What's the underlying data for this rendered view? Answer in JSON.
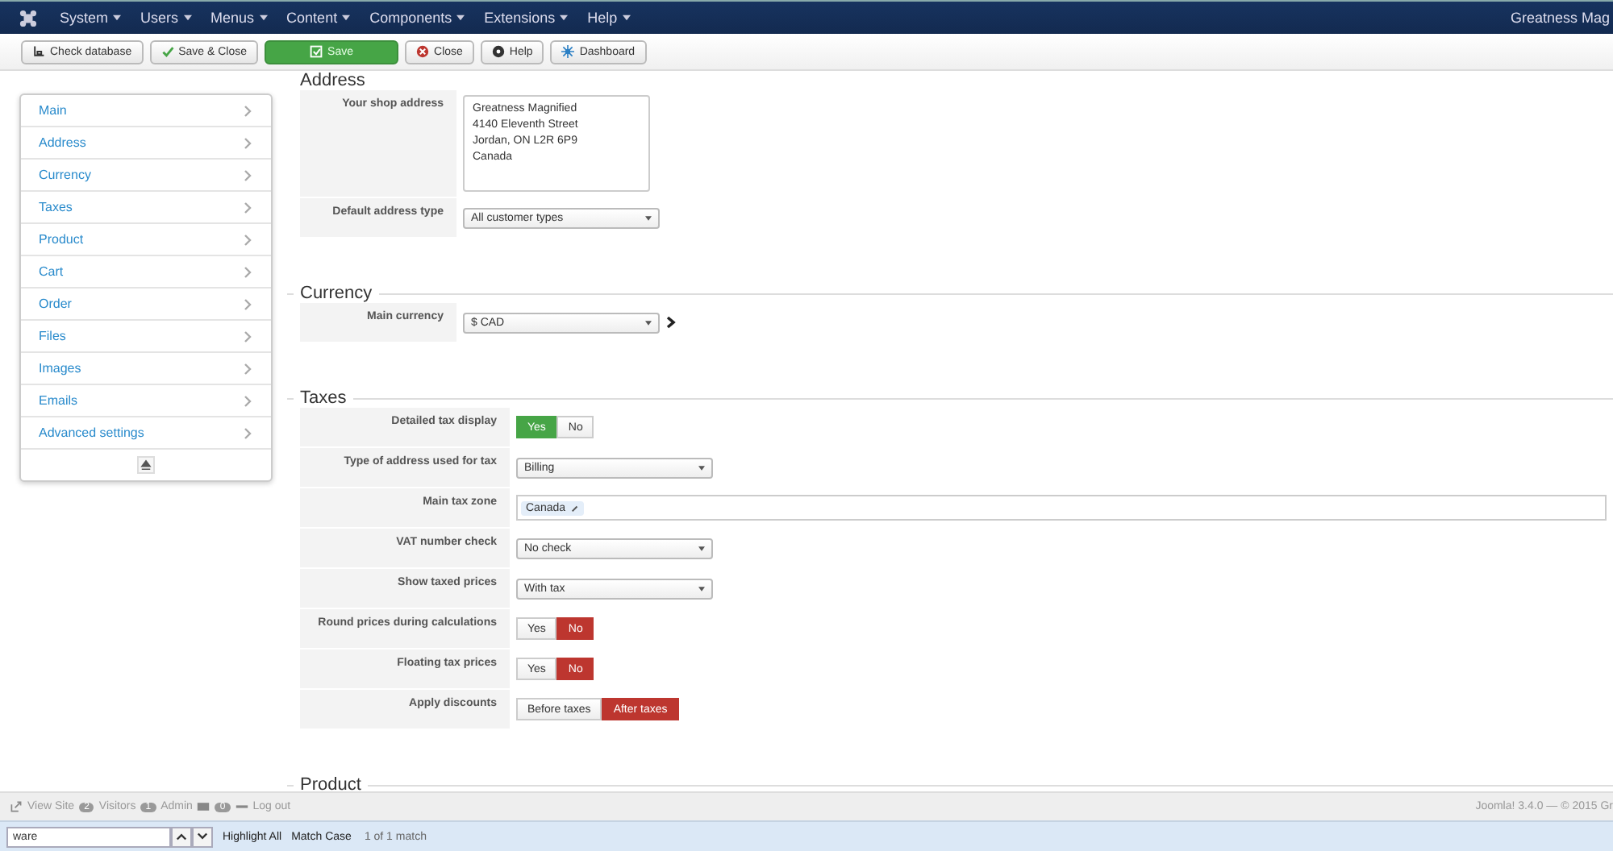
{
  "navbar": {
    "menus": [
      "System",
      "Users",
      "Menus",
      "Content",
      "Components",
      "Extensions",
      "Help"
    ],
    "site_name": "Greatness Mag"
  },
  "toolbar": [
    {
      "kind": "database",
      "label": "Check database"
    },
    {
      "kind": "check",
      "label": "Save & Close"
    },
    {
      "kind": "save",
      "label": "Save"
    },
    {
      "kind": "close",
      "label": "Close"
    },
    {
      "kind": "help",
      "label": "Help"
    },
    {
      "kind": "dashboard",
      "label": "Dashboard"
    }
  ],
  "sidebar": {
    "items": [
      "Main",
      "Address",
      "Currency",
      "Taxes",
      "Product",
      "Cart",
      "Order",
      "Files",
      "Images",
      "Emails",
      "Advanced settings"
    ]
  },
  "sections": [
    {
      "title": "Address",
      "fields": [
        {
          "label": "Your shop address",
          "kind": "textarea",
          "lines": [
            "Greatness Magnified",
            "4140 Eleventh Street",
            "Jordan, ON L2R 6P9",
            "Canada"
          ]
        },
        {
          "label": "Default address type",
          "kind": "select",
          "value": "All customer types"
        }
      ]
    },
    {
      "title": "Currency",
      "fields": [
        {
          "label": "Main currency",
          "kind": "select",
          "value": "$ CAD",
          "link": true
        }
      ]
    },
    {
      "title": "Taxes",
      "fields": [
        {
          "label": "Detailed tax display",
          "kind": "toggle",
          "options": [
            {
              "label": "Yes",
              "selected": true,
              "color": "#46a546"
            },
            {
              "label": "No",
              "selected": false
            }
          ]
        },
        {
          "label": "Type of address used for tax",
          "kind": "select",
          "value": "Billing"
        },
        {
          "label": "Main tax zone",
          "kind": "tags",
          "tags": [
            "Canada"
          ]
        },
        {
          "label": "VAT number check",
          "kind": "select",
          "value": "No check"
        },
        {
          "label": "Show taxed prices",
          "kind": "select",
          "value": "With tax"
        },
        {
          "label": "Round prices during calculations",
          "kind": "toggle",
          "options": [
            {
              "label": "Yes",
              "selected": false
            },
            {
              "label": "No",
              "selected": true,
              "color": "#bd362f"
            }
          ]
        },
        {
          "label": "Floating tax prices",
          "kind": "toggle",
          "options": [
            {
              "label": "Yes",
              "selected": false
            },
            {
              "label": "No",
              "selected": true,
              "color": "#bd362f"
            }
          ]
        },
        {
          "label": "Apply discounts",
          "kind": "toggle",
          "options": [
            {
              "label": "Before taxes",
              "selected": false
            },
            {
              "label": "After taxes",
              "selected": true,
              "color": "#bd362f"
            }
          ]
        }
      ]
    },
    {
      "title": "Product"
    }
  ],
  "status_bar": {
    "view_site": "View Site",
    "visitors_count": "2",
    "visitors": "Visitors",
    "admin_count": "1",
    "admin": "Admin",
    "messages_count": "0",
    "logout": "Log out",
    "version": "Joomla! 3.4.0 — © 2015 Gr"
  },
  "find_bar": {
    "value": "ware",
    "highlight_all": "Highlight All",
    "match_case": "Match Case",
    "result": "1 of 1 match"
  }
}
